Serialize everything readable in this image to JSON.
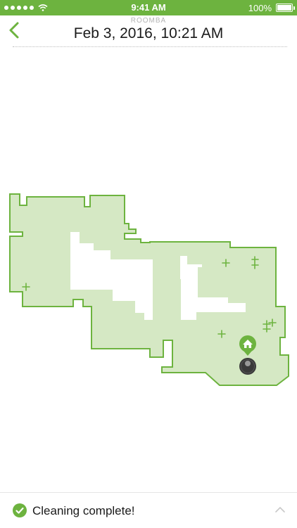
{
  "status_bar": {
    "time": "9:41 AM",
    "battery": "100%"
  },
  "header": {
    "subtitle": "ROOMBA",
    "title": "Feb 3, 2016, 10:21 AM"
  },
  "footer": {
    "status": "Cleaning complete!"
  },
  "colors": {
    "accent": "#6db33f",
    "map_fill": "#d5e8c4",
    "robot": "#3a3a3a"
  },
  "icons": {
    "back": "chevron-left-icon",
    "home_base": "home-icon",
    "robot": "roomba-icon",
    "dirt": "plus-icon",
    "done": "check-icon",
    "expand": "chevron-up-icon"
  }
}
